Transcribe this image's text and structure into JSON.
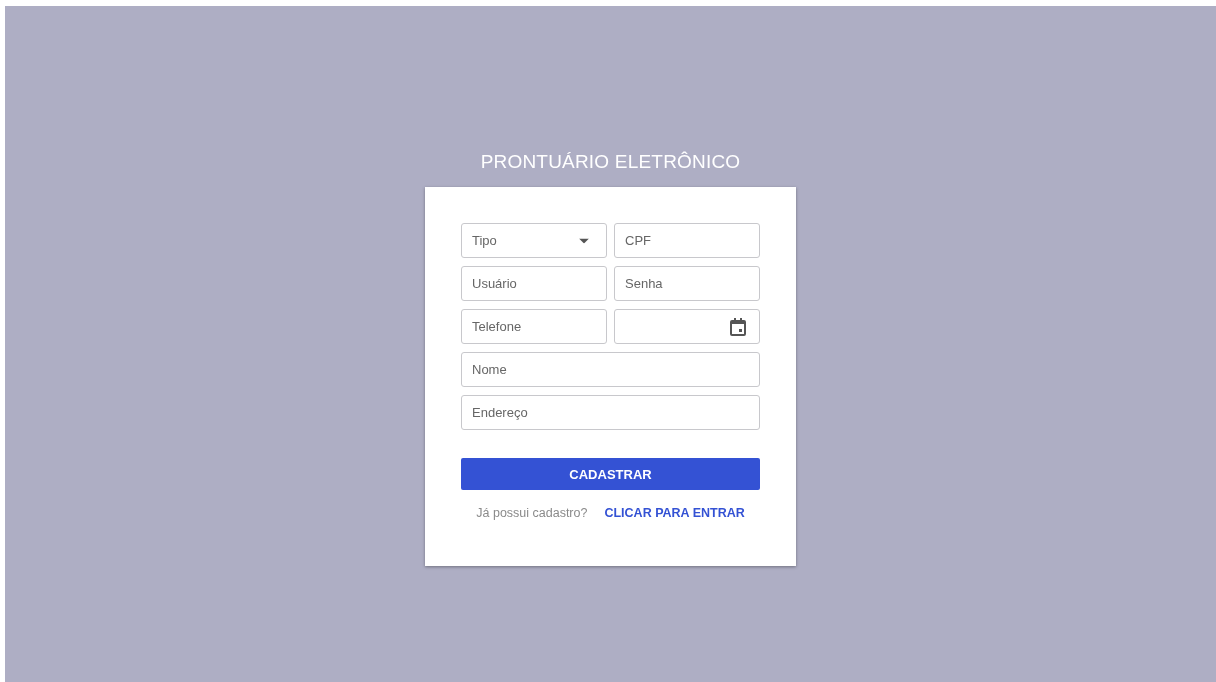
{
  "title": "PRONTUÁRIO ELETRÔNICO",
  "fields": [
    {
      "kind": "select",
      "placeholder": "Tipo",
      "wide": false
    },
    {
      "kind": "text",
      "placeholder": "CPF",
      "wide": false
    },
    {
      "kind": "text",
      "placeholder": "Usuário",
      "wide": false
    },
    {
      "kind": "text",
      "placeholder": "Senha",
      "wide": false
    },
    {
      "kind": "text",
      "placeholder": "Telefone",
      "wide": false
    },
    {
      "kind": "date",
      "wide": false
    },
    {
      "kind": "text",
      "placeholder": "Nome",
      "wide": true
    },
    {
      "kind": "text",
      "placeholder": "Endereço",
      "wide": true
    }
  ],
  "submit_button": "CADASTRAR",
  "login_prompt": {
    "text": "Já possui cadastro?",
    "link": "CLICAR PARA ENTRAR"
  }
}
